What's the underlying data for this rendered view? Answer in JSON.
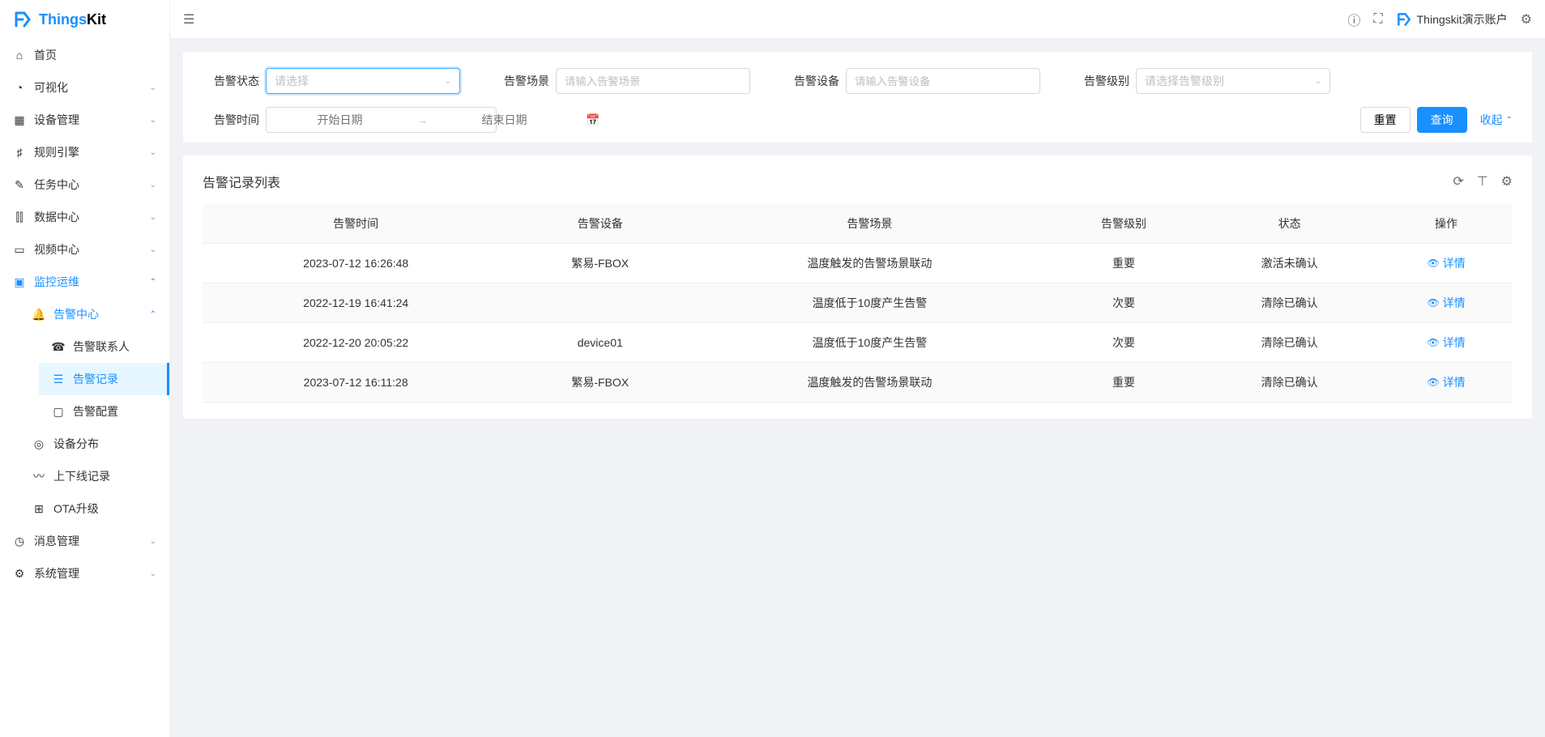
{
  "brand": {
    "name1": "Things",
    "name2": "Kit"
  },
  "topbar": {
    "user_label": "Thingskit演示账户"
  },
  "sidebar": {
    "home": "首页",
    "visual": "可视化",
    "device": "设备管理",
    "rule": "规则引擎",
    "task": "任务中心",
    "data": "数据中心",
    "video": "视频中心",
    "monitor": "监控运维",
    "alarm_center": "告警中心",
    "alarm_contacts": "告警联系人",
    "alarm_records": "告警记录",
    "alarm_config": "告警配置",
    "device_dist": "设备分布",
    "online_record": "上下线记录",
    "ota": "OTA升级",
    "message": "消息管理",
    "system": "系统管理"
  },
  "filters": {
    "status_label": "告警状态",
    "status_placeholder": "请选择",
    "scene_label": "告警场景",
    "scene_placeholder": "请输入告警场景",
    "device_label": "告警设备",
    "device_placeholder": "请输入告警设备",
    "level_label": "告警级别",
    "level_placeholder": "请选择告警级别",
    "time_label": "告警时间",
    "start_date_placeholder": "开始日期",
    "end_date_placeholder": "结束日期",
    "date_sep": "→",
    "reset_btn": "重置",
    "query_btn": "查询",
    "collapse_btn": "收起"
  },
  "table": {
    "title": "告警记录列表",
    "columns": [
      "告警时间",
      "告警设备",
      "告警场景",
      "告警级别",
      "状态",
      "操作"
    ],
    "action_label": "详情",
    "rows": [
      {
        "time": "2023-07-12 16:26:48",
        "device": "繁易-FBOX",
        "scene": "温度触发的告警场景联动",
        "level": "重要",
        "status": "激活未确认"
      },
      {
        "time": "2022-12-19 16:41:24",
        "device": "",
        "scene": "温度低于10度产生告警",
        "level": "次要",
        "status": "清除已确认"
      },
      {
        "time": "2022-12-20 20:05:22",
        "device": "device01",
        "scene": "温度低于10度产生告警",
        "level": "次要",
        "status": "清除已确认"
      },
      {
        "time": "2023-07-12 16:11:28",
        "device": "繁易-FBOX",
        "scene": "温度触发的告警场景联动",
        "level": "重要",
        "status": "清除已确认"
      }
    ]
  }
}
